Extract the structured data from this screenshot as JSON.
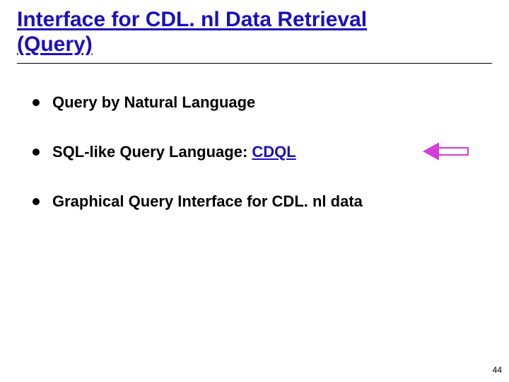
{
  "title_line1": "Interface for CDL. nl Data Retrieval",
  "title_line2": "(Query)",
  "bullets": {
    "b1": "Query by Natural Language",
    "b2_prefix": "SQL-like Query Language: ",
    "b2_emph": "CDQL",
    "b3": "Graphical Query Interface for CDL. nl data"
  },
  "arrow_color": "#d63cd6",
  "page_number": "44"
}
